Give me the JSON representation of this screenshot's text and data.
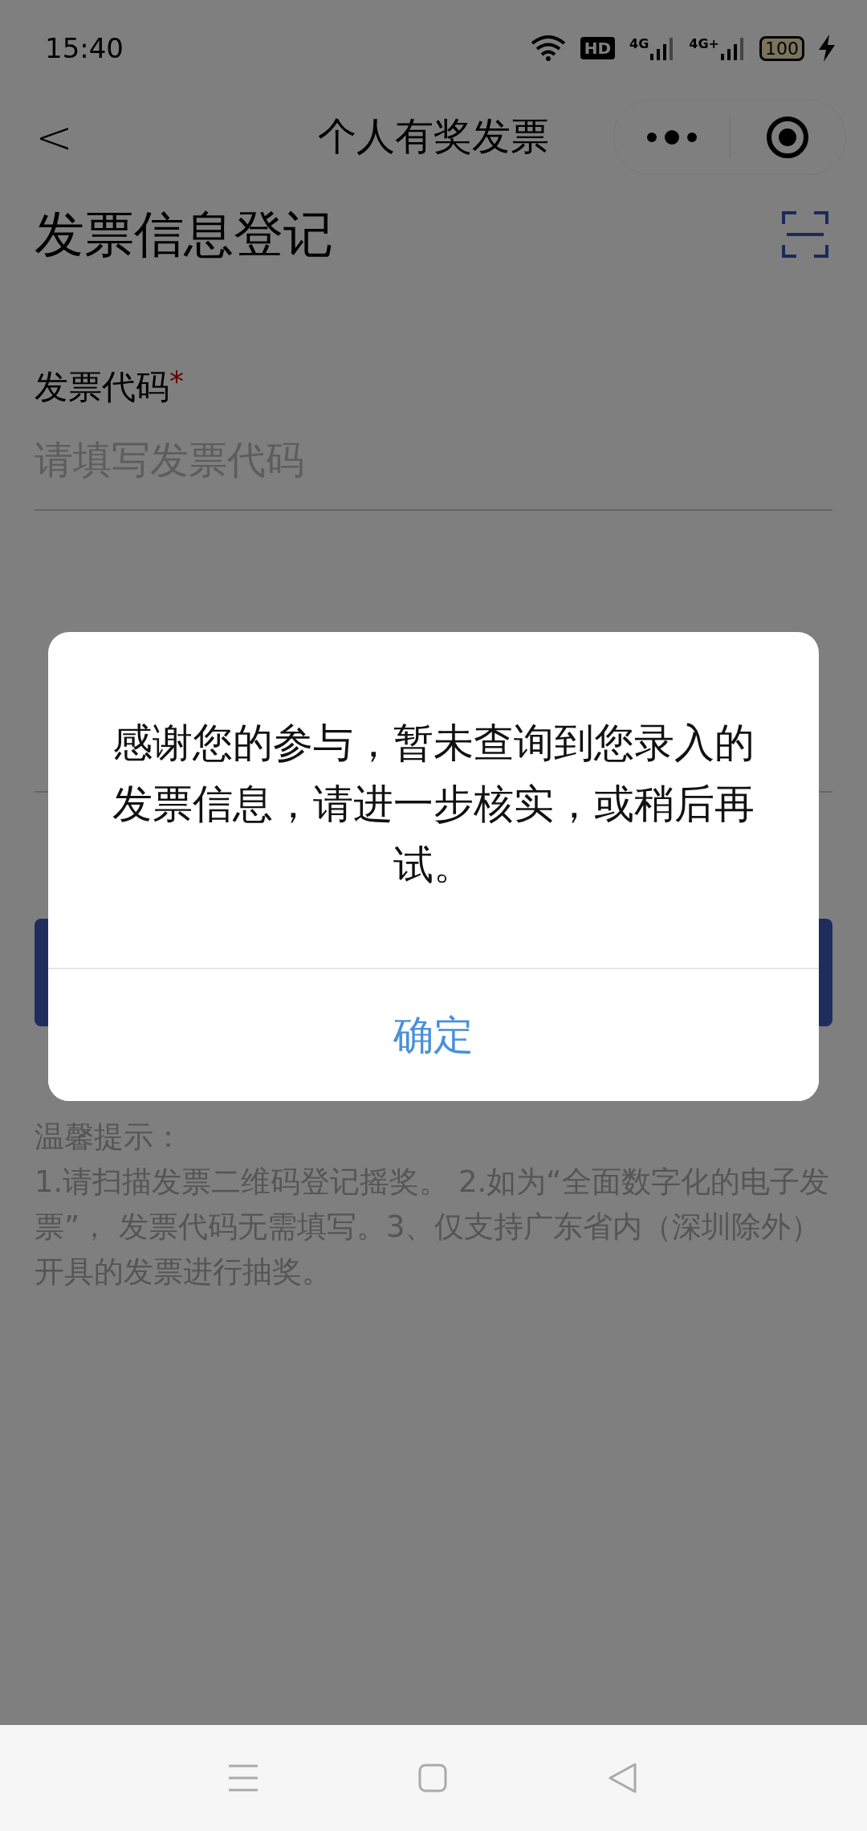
{
  "status_bar": {
    "time": "15:40",
    "hd": "HD",
    "signals": [
      "4G",
      "4G+"
    ],
    "battery": "100"
  },
  "nav": {
    "back": "<",
    "title": "个人有奖发票"
  },
  "page_title": "发票信息登记",
  "fields": [
    {
      "label": "发票代码",
      "required_mark": "*",
      "placeholder": "请填写发票代码"
    }
  ],
  "tips": {
    "title": "温馨提示：",
    "text": "1.请扫描发票二维码登记摇奖。 2.如为“全面数字化的电子发票”， 发票代码无需填写。3、仅支持广东省内（深圳除外）开具的发票进行抽奖。"
  },
  "dialog": {
    "message": "感谢您的参与，暂未查询到您录入的发票信息，请进一步核实，或稍后再试。",
    "button": "确定"
  }
}
